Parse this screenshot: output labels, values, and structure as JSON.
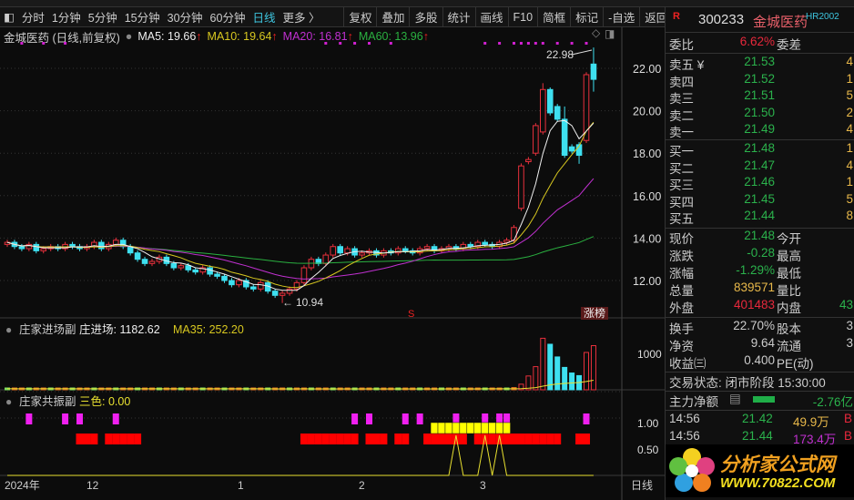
{
  "toolbar": {
    "items": [
      "分时",
      "1分钟",
      "5分钟",
      "15分钟",
      "30分钟",
      "60分钟",
      "日线",
      "更多 〉"
    ],
    "active": "日线",
    "buttons": [
      "复权",
      "叠加",
      "多股",
      "统计",
      "画线",
      "F10",
      "简框",
      "标记",
      "-自选",
      "返回"
    ]
  },
  "legend": {
    "title": "金城医药 (日线,前复权)",
    "ma5": "MA5: 19.66",
    "ma10": "MA10: 19.64",
    "ma20": "MA20: 16.81",
    "ma60": "MA60: 13.96"
  },
  "main_axis": [
    "22.00",
    "20.00",
    "18.00",
    "16.00",
    "14.00",
    "12.00"
  ],
  "annotations": {
    "high": "22.98",
    "low": "10.94",
    "s_marker": "S",
    "zhangbang": "涨榜"
  },
  "panel2": {
    "title": "庄家进场副",
    "label": "庄进场: 1182.62",
    "ma": "MA35: 252.20",
    "axis": [
      "1000"
    ]
  },
  "panel3": {
    "title": "庄家共振副",
    "label": "三色: 0.00",
    "axis": [
      "1.00",
      "0.50"
    ]
  },
  "xaxis": {
    "labels": [
      "2024年",
      "12",
      "1",
      "2",
      "3"
    ],
    "period": "日线"
  },
  "chart_data": {
    "type": "candlestick",
    "open": [
      13.7,
      13.8,
      13.6,
      13.5,
      13.7,
      13.4,
      13.5,
      13.6,
      13.5,
      13.7,
      13.6,
      13.5,
      13.6,
      13.8,
      13.5,
      13.7,
      13.9,
      13.6,
      13.3,
      13.0,
      12.8,
      12.9,
      13.1,
      12.8,
      12.6,
      12.7,
      12.5,
      12.4,
      12.6,
      12.3,
      12.2,
      12.0,
      11.8,
      12.0,
      11.7,
      11.6,
      11.9,
      11.5,
      11.3,
      11.4,
      11.6,
      11.9,
      12.6,
      13.0,
      12.8,
      13.2,
      13.6,
      13.3,
      13.5,
      13.2,
      13.3,
      13.4,
      13.2,
      13.4,
      13.3,
      13.5,
      13.4,
      13.3,
      13.5,
      13.6,
      13.4,
      13.5,
      13.6,
      13.5,
      13.7,
      13.6,
      13.8,
      13.7,
      13.6,
      13.8,
      13.9,
      15.4,
      17.6,
      18.0,
      19.0,
      21.0,
      20.2,
      19.6,
      18.3,
      18.4,
      18.6,
      22.2
    ],
    "close": [
      13.8,
      13.6,
      13.5,
      13.7,
      13.4,
      13.5,
      13.6,
      13.5,
      13.7,
      13.6,
      13.5,
      13.6,
      13.8,
      13.5,
      13.7,
      13.9,
      13.6,
      13.3,
      13.0,
      12.8,
      12.9,
      13.1,
      12.8,
      12.6,
      12.7,
      12.5,
      12.4,
      12.6,
      12.3,
      12.2,
      12.0,
      11.8,
      12.0,
      11.7,
      11.6,
      11.9,
      11.5,
      11.3,
      11.4,
      11.6,
      11.9,
      12.6,
      13.0,
      12.8,
      13.2,
      13.6,
      13.3,
      13.5,
      13.2,
      13.3,
      13.4,
      13.2,
      13.4,
      13.3,
      13.5,
      13.4,
      13.3,
      13.5,
      13.6,
      13.4,
      13.5,
      13.6,
      13.5,
      13.7,
      13.6,
      13.8,
      13.7,
      13.6,
      13.8,
      13.9,
      14.5,
      17.4,
      17.7,
      19.3,
      21.0,
      19.9,
      19.6,
      17.9,
      18.1,
      17.9,
      21.7,
      21.48
    ],
    "high_overrides": {
      "81": 22.98,
      "74": 21.3,
      "75": 21.1,
      "77": 20.2
    },
    "low_overrides": {
      "38": 10.94,
      "79": 17.5,
      "81": 20.9
    },
    "ylim": [
      10.5,
      23.2
    ],
    "zhuangjinchang": [
      30,
      25,
      28,
      22,
      30,
      26,
      24,
      30,
      28,
      25,
      22,
      30,
      26,
      24,
      28,
      30,
      25,
      22,
      26,
      28,
      24,
      30,
      25,
      28,
      22,
      26,
      30,
      24,
      28,
      25,
      22,
      26,
      30,
      28,
      24,
      25,
      20,
      22,
      24,
      26,
      28,
      30,
      25,
      22,
      24,
      26,
      28,
      25,
      30,
      22,
      24,
      26,
      28,
      25,
      30,
      24,
      26,
      28,
      25,
      22,
      30,
      26,
      28,
      24,
      30,
      26,
      28,
      32,
      35,
      40,
      60,
      150,
      370,
      620,
      1380,
      1220,
      880,
      600,
      450,
      380,
      1000,
      1182.62
    ],
    "pink_marks": [
      3,
      8,
      10,
      15,
      48,
      50,
      55,
      57,
      62,
      66,
      68,
      69,
      80
    ],
    "red_marks": [
      10,
      11,
      12,
      14,
      15,
      16,
      17,
      18,
      41,
      42,
      43,
      44,
      45,
      46,
      47,
      48,
      50,
      51,
      52,
      54,
      55,
      58,
      59,
      60,
      61,
      62,
      63,
      65,
      66,
      67,
      68,
      69,
      70,
      71,
      72,
      73,
      74,
      75,
      76,
      79,
      80
    ],
    "yellow_marks": [
      59,
      60,
      61,
      62,
      63,
      64,
      65,
      66,
      67,
      68,
      69
    ],
    "sanse_peaks": [
      62,
      66,
      68
    ]
  },
  "quote": {
    "code": "300233",
    "name": "金城医药",
    "badge": "R",
    "tag": "HR2002",
    "weibi_label": "委比",
    "weibi": "6.62%",
    "weicha_label": "委差",
    "asks": [
      {
        "l": "卖五 ¥",
        "p": "21.53",
        "v": "4"
      },
      {
        "l": "卖四",
        "p": "21.52",
        "v": "1"
      },
      {
        "l": "卖三",
        "p": "21.51",
        "v": "5"
      },
      {
        "l": "卖二",
        "p": "21.50",
        "v": "2"
      },
      {
        "l": "卖一",
        "p": "21.49",
        "v": "4"
      }
    ],
    "bids": [
      {
        "l": "买一",
        "p": "21.48",
        "v": "1"
      },
      {
        "l": "买二",
        "p": "21.47",
        "v": "4"
      },
      {
        "l": "买三",
        "p": "21.46",
        "v": "1"
      },
      {
        "l": "买四",
        "p": "21.45",
        "v": "5"
      },
      {
        "l": "买五",
        "p": "21.44",
        "v": "8"
      }
    ],
    "stats1": [
      {
        "l": "现价",
        "v": "21.48",
        "l2": "今开",
        "r": ""
      },
      {
        "l": "涨跌",
        "v": "-0.28",
        "l2": "最高",
        "r": ""
      },
      {
        "l": "涨幅",
        "v": "-1.29%",
        "l2": "最低",
        "r": ""
      },
      {
        "l": "总量",
        "v": "839571",
        "l2": "量比",
        "r": ""
      },
      {
        "l": "外盘",
        "v": "401483",
        "l2": "内盘",
        "r": "43"
      }
    ],
    "stats2": [
      {
        "l": "换手",
        "v": "22.70%",
        "l2": "股本",
        "r": "3"
      },
      {
        "l": "净资",
        "v": "9.64",
        "l2": "流通",
        "r": "3"
      },
      {
        "l": "收益㈢",
        "v": "0.400",
        "l2": "PE(动)",
        "r": ""
      }
    ],
    "status": "交易状态: 闭市阶段 15:30:00",
    "main_net_label": "主力净额",
    "main_net": "-2.76亿",
    "ticks": [
      {
        "t": "14:56",
        "p": "21.42",
        "v": "49.9万",
        "f": "B"
      },
      {
        "t": "14:56",
        "p": "21.44",
        "v": "173.4万",
        "f": "B"
      }
    ],
    "logo_text": "分析家公式网",
    "logo_url": "WWW.70822.COM"
  }
}
